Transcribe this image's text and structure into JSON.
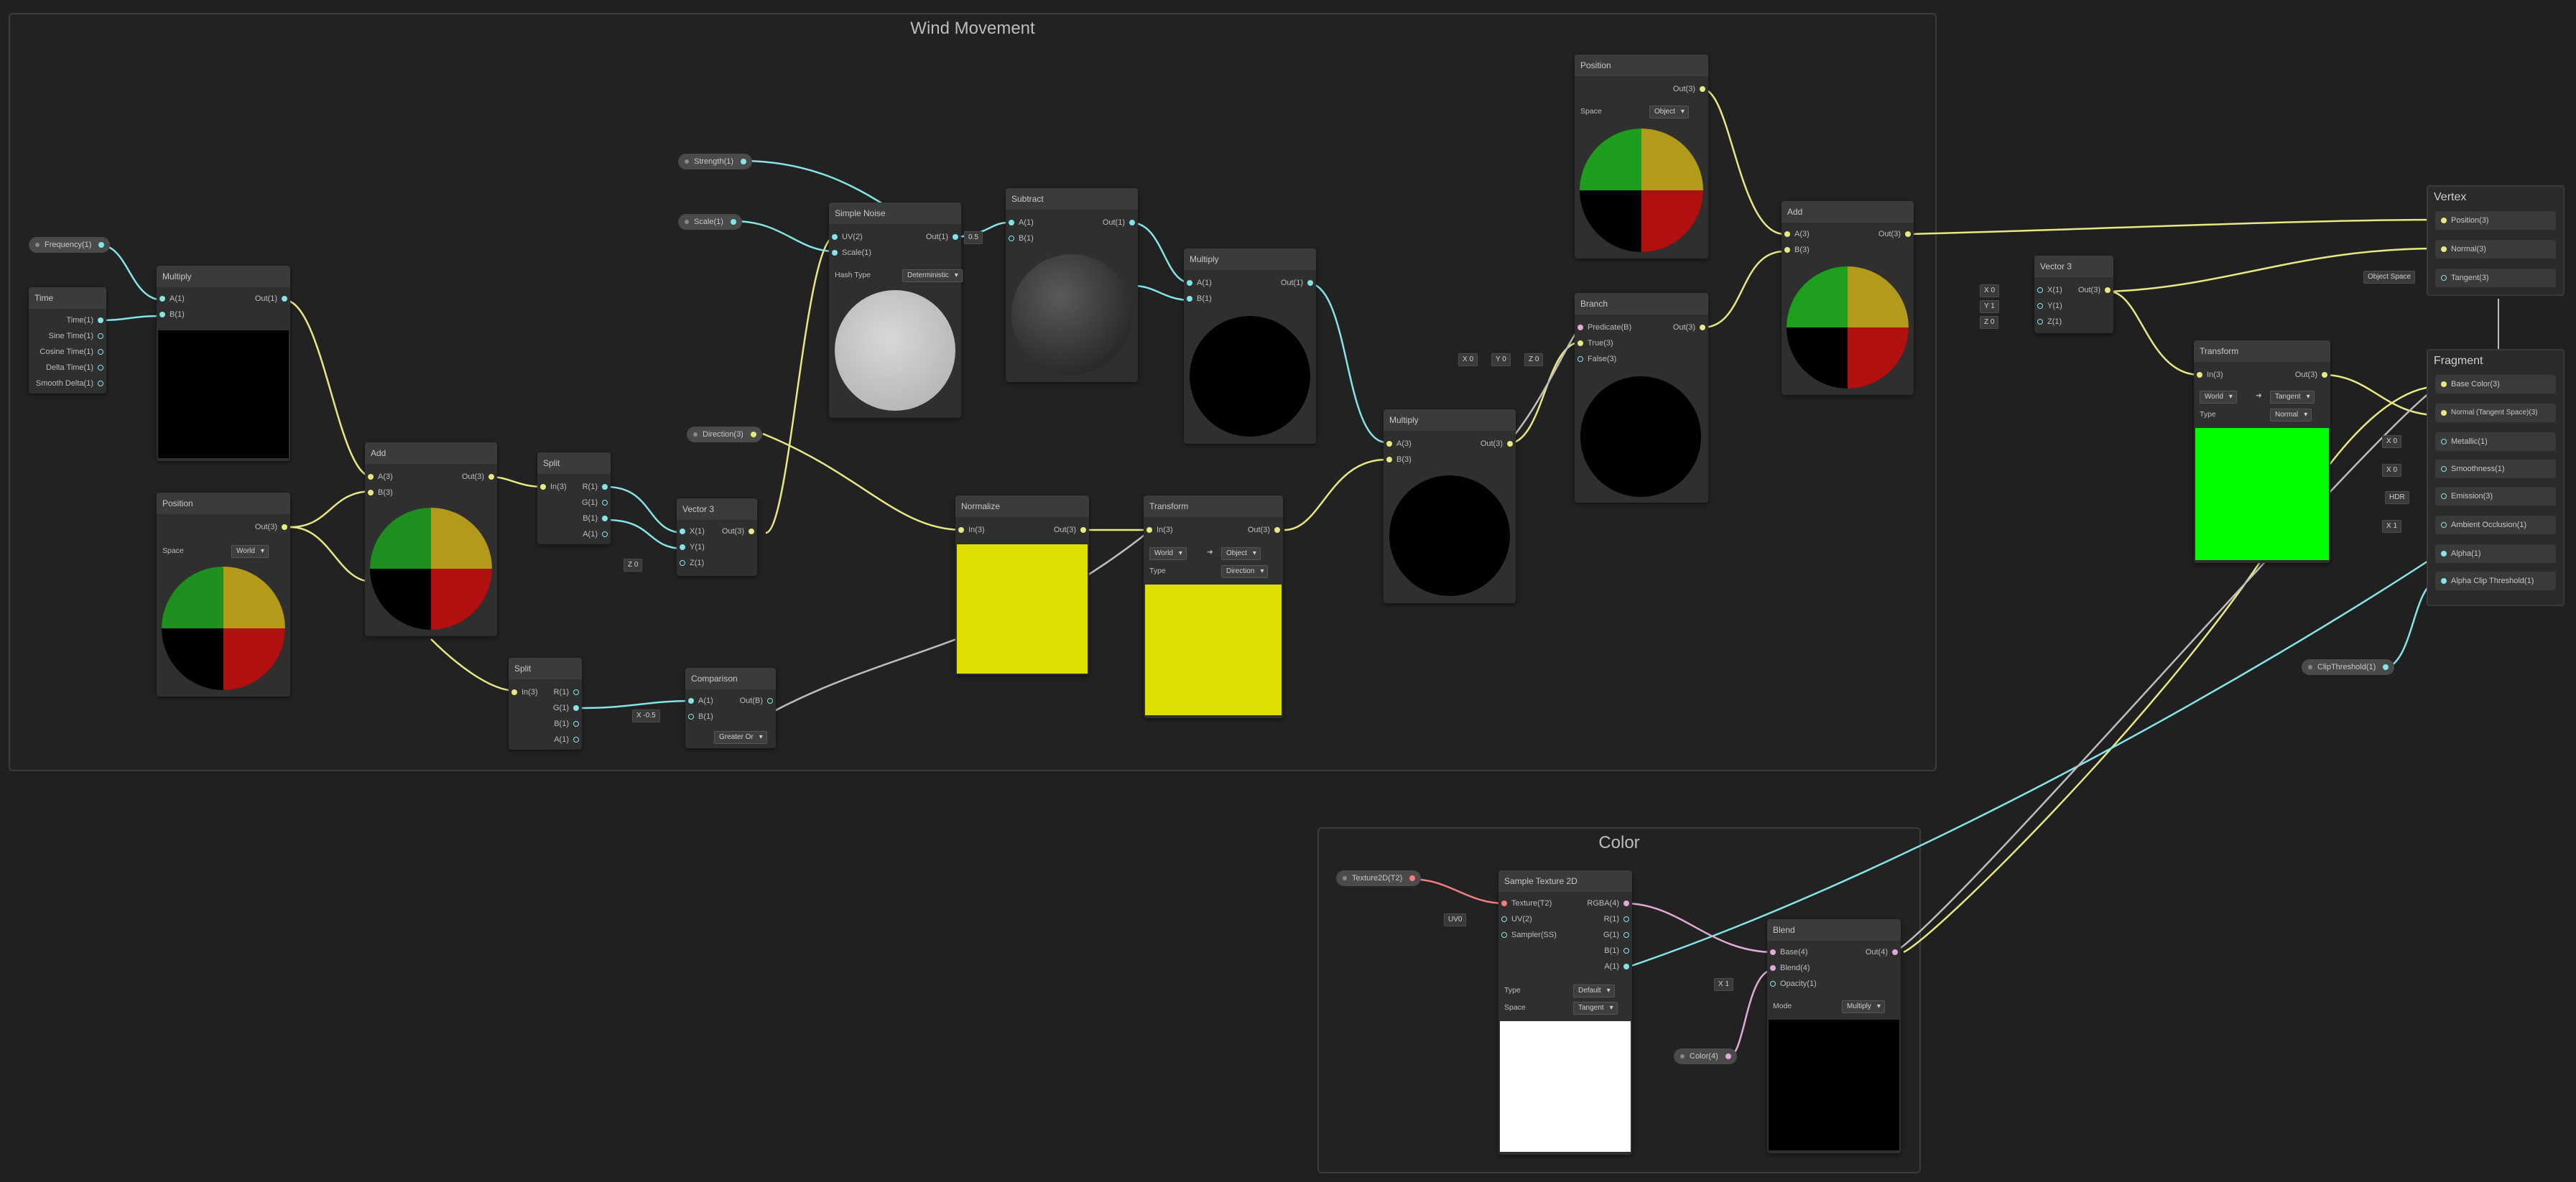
{
  "groups": {
    "wind": "Wind Movement",
    "color": "Color"
  },
  "properties": {
    "frequency": "Frequency(1)",
    "strength": "Strength(1)",
    "scale": "Scale(1)",
    "direction": "Direction(3)",
    "texture": "Texture2D(T2)",
    "color": "Color(4)",
    "clip": "ClipThreshold(1)"
  },
  "nodes": {
    "time": {
      "title": "Time",
      "outputs": [
        "Time(1)",
        "Sine Time(1)",
        "Cosine Time(1)",
        "Delta Time(1)",
        "Smooth Delta(1)"
      ]
    },
    "multiply1": {
      "title": "Multiply",
      "a": "A(1)",
      "b": "B(1)",
      "out": "Out(1)"
    },
    "position1": {
      "title": "Position",
      "out": "Out(3)",
      "space_label": "Space",
      "space": "World"
    },
    "add1": {
      "title": "Add",
      "a": "A(3)",
      "b": "B(3)",
      "out": "Out(3)"
    },
    "split1": {
      "title": "Split",
      "in": "In(3)",
      "r": "R(1)",
      "g": "G(1)",
      "b": "B(1)",
      "a": "A(1)"
    },
    "split2": {
      "title": "Split",
      "in": "In(3)",
      "r": "R(1)",
      "g": "G(1)",
      "b": "B(1)",
      "a": "A(1)"
    },
    "vector3a": {
      "title": "Vector 3",
      "x": "X(1)",
      "y": "Y(1)",
      "z": "Z(1)",
      "out": "Out(3)",
      "z_label": "Z",
      "z_val": "0"
    },
    "comparison": {
      "title": "Comparison",
      "a": "A(1)",
      "b": "B(1)",
      "out": "Out(B)",
      "b_label": "X",
      "b_val": "-0.5",
      "mode": "Greater Or"
    },
    "noise": {
      "title": "Simple Noise",
      "uv": "UV(2)",
      "scale": "Scale(1)",
      "out": "Out(1)",
      "hash_label": "Hash Type",
      "hash": "Deterministic"
    },
    "subtract": {
      "title": "Subtract",
      "a": "A(1)",
      "b": "B(1)",
      "out": "Out(1)",
      "b_val": "0.5"
    },
    "multiply2": {
      "title": "Multiply",
      "a": "A(1)",
      "b": "B(1)",
      "out": "Out(1)"
    },
    "normalize": {
      "title": "Normalize",
      "in": "In(3)",
      "out": "Out(3)"
    },
    "transform1": {
      "title": "Transform",
      "in": "In(3)",
      "out": "Out(3)",
      "from": "World",
      "to": "Object",
      "type_label": "Type",
      "type": "Direction"
    },
    "multiply3": {
      "title": "Multiply",
      "a": "A(3)",
      "b": "B(3)",
      "out": "Out(3)"
    },
    "position2": {
      "title": "Position",
      "out": "Out(3)",
      "space_label": "Space",
      "space": "Object"
    },
    "branch": {
      "title": "Branch",
      "predicate": "Predicate(B)",
      "true": "True(3)",
      "false": "False(3)",
      "out": "Out(3)"
    },
    "add2": {
      "title": "Add",
      "a": "A(3)",
      "b": "B(3)",
      "out": "Out(3)"
    },
    "vector3b": {
      "title": "Vector 3",
      "x": "X(1)",
      "y": "Y(1)",
      "z": "Z(1)",
      "out": "Out(3)",
      "vals": [
        [
          "X",
          "0"
        ],
        [
          "Y",
          "1"
        ],
        [
          "Z",
          "0"
        ]
      ]
    },
    "transform2": {
      "title": "Transform",
      "in": "In(3)",
      "out": "Out(3)",
      "from": "World",
      "to": "Tangent",
      "type_label": "Type",
      "type": "Normal"
    },
    "sample": {
      "title": "Sample Texture 2D",
      "inputs": [
        "Texture(T2)",
        "UV(2)",
        "Sampler(SS)"
      ],
      "outputs": [
        "RGBA(4)",
        "R(1)",
        "G(1)",
        "B(1)",
        "A(1)"
      ],
      "uv_chip": "UV0",
      "type_label": "Type",
      "type": "Default",
      "space_label": "Space",
      "space": "Tangent"
    },
    "blend": {
      "title": "Blend",
      "base": "Base(4)",
      "blend": "Blend(4)",
      "opacity": "Opacity(1)",
      "out": "Out(4)",
      "opacity_label": "X",
      "opacity_val": "1",
      "mode_label": "Mode",
      "mode": "Multiply"
    }
  },
  "branch_chips": [
    [
      "X",
      "0"
    ],
    [
      "Y",
      "0"
    ],
    [
      "Z",
      "0"
    ]
  ],
  "vertex": {
    "title": "Vertex",
    "slots": [
      "Position(3)",
      "Normal(3)",
      "Tangent(3)"
    ],
    "tangent_chip": "Object Space"
  },
  "fragment": {
    "title": "Fragment",
    "slots": [
      "Base Color(3)",
      "Normal (Tangent Space)(3)",
      "Metallic(1)",
      "Smoothness(1)",
      "Emission(3)",
      "Ambient Occlusion(1)",
      "Alpha(1)",
      "Alpha Clip Threshold(1)"
    ],
    "metallic": [
      "X",
      "0"
    ],
    "smoothness": [
      "X",
      "0"
    ],
    "emission": "HDR",
    "ao": [
      "X",
      "1"
    ]
  },
  "colors": {
    "bg": "#202020",
    "yellow": "#e8e883",
    "cyan": "#84e4e7",
    "pink": "#e0a9d8",
    "red": "#f47e7e",
    "preview_yellow": "#dede00",
    "preview_green": "#00ff00"
  }
}
